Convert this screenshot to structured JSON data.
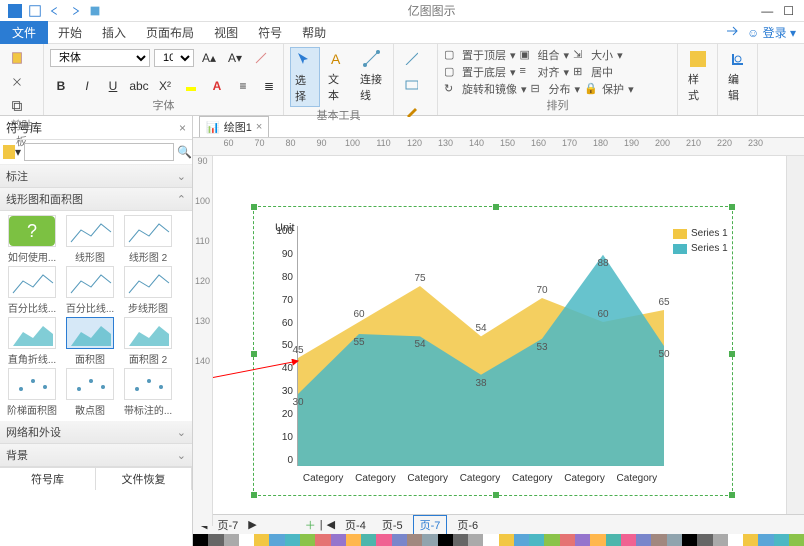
{
  "app_title": "亿图图示",
  "menubar": {
    "file": "文件",
    "tabs": [
      "开始",
      "插入",
      "页面布局",
      "视图",
      "符号",
      "帮助"
    ],
    "login": "登录"
  },
  "ribbon": {
    "clipboard_label": "剪贴板",
    "font_name": "宋体",
    "font_size": "10",
    "font_group_label": "字体",
    "tools": {
      "select": "选择",
      "text": "文本",
      "connect": "连接线",
      "label": "基本工具"
    },
    "arrange": {
      "front": "置于顶层",
      "back": "置于底层",
      "rotate": "旋转和镜像",
      "group": "组合",
      "align": "对齐",
      "distribute": "分布",
      "size": "大小",
      "center": "居中",
      "protect": "保护",
      "label": "排列"
    },
    "style": "样式",
    "edit": "编辑"
  },
  "sidebar": {
    "title": "符号库",
    "sections": [
      "标注",
      "线形图和面积图",
      "网络和外设",
      "背景"
    ],
    "thumbs": [
      "如何使用...",
      "线形图",
      "线形图 2",
      "百分比线...",
      "百分比线...",
      "步线形图",
      "直角折线...",
      "面积图",
      "面积图 2",
      "阶梯面积图",
      "散点图",
      "带标注的..."
    ],
    "bottom": [
      "符号库",
      "文件恢复"
    ]
  },
  "doc_tab": "绘图1",
  "ruler_h": [
    "60",
    "70",
    "80",
    "90",
    "100",
    "110",
    "120",
    "130",
    "140",
    "150",
    "160",
    "170",
    "180",
    "190",
    "200",
    "210",
    "220",
    "230"
  ],
  "ruler_v": [
    "90",
    "100",
    "110",
    "120",
    "130",
    "140"
  ],
  "page_tabs": {
    "left": "页-7",
    "items": [
      "页-4",
      "页-5",
      "页-7",
      "页-6"
    ]
  },
  "chart_data": {
    "type": "area",
    "ylabel": "Unit",
    "yticks": [
      0,
      10,
      20,
      30,
      40,
      50,
      60,
      70,
      80,
      90,
      100
    ],
    "categories": [
      "Category",
      "Category",
      "Category",
      "Category",
      "Category",
      "Category",
      "Category"
    ],
    "series": [
      {
        "name": "Series 1",
        "color": "#f2c744",
        "values": [
          45,
          60,
          75,
          54,
          70,
          60,
          65
        ]
      },
      {
        "name": "Series 1",
        "color": "#4cb8c4",
        "values": [
          30,
          55,
          54,
          38,
          53,
          88,
          50
        ]
      }
    ],
    "labels_top": [
      45,
      60,
      75,
      54,
      70,
      60,
      65
    ],
    "labels_bottom": [
      30,
      55,
      54,
      38,
      53,
      88,
      50
    ]
  },
  "colors_strip": [
    "#000",
    "#666",
    "#aaa",
    "#fff",
    "#f2c744",
    "#5aa6d8",
    "#4cb8c4",
    "#8bc34a",
    "#e57373",
    "#9575cd",
    "#ffb74d",
    "#4db6ac",
    "#f06292",
    "#7986cb",
    "#a1887f",
    "#90a4ae"
  ]
}
